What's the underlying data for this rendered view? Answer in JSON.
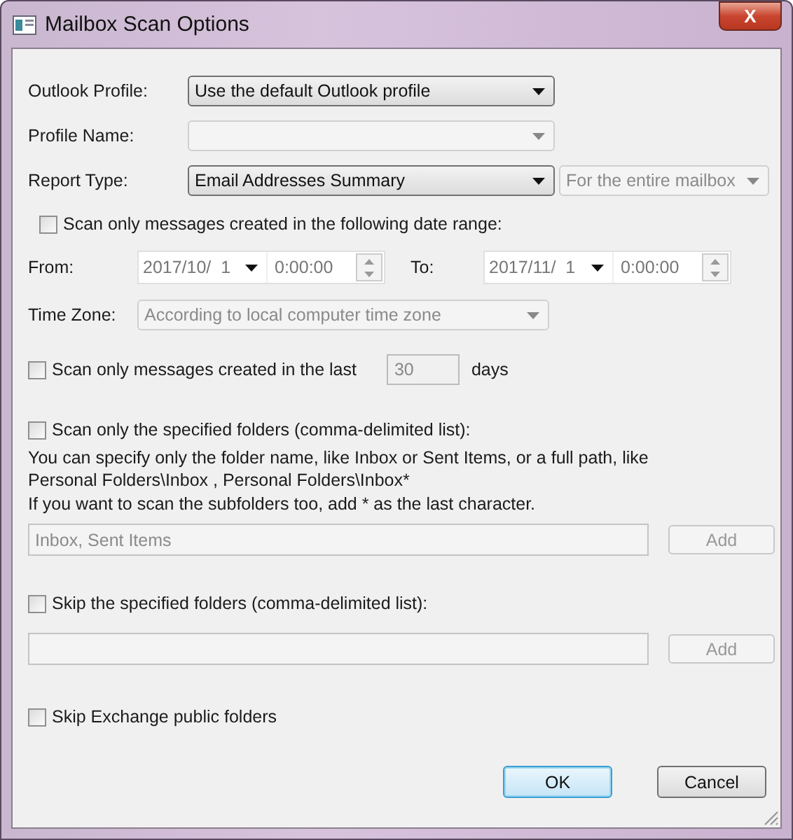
{
  "window": {
    "title": "Mailbox Scan Options",
    "close": "X"
  },
  "outlook_profile": {
    "label": "Outlook Profile:",
    "value": "Use the default Outlook profile",
    "disabled": false
  },
  "profile_name": {
    "label": "Profile Name:",
    "disabled": true
  },
  "report_type": {
    "label": "Report Type:",
    "value": "Email Addresses Summary",
    "disabled": false,
    "scope": {
      "value": "For the entire mailbox",
      "disabled": true
    }
  },
  "date_range": {
    "label": "Scan only messages created in the following date range:",
    "checked": false,
    "from": {
      "label": "From:",
      "date": "2017/10/  1",
      "time": "0:00:00"
    },
    "to": {
      "label": "To:",
      "date": "2017/11/  1",
      "time": "0:00:00"
    },
    "time_zone": {
      "label": "Time Zone:",
      "value": "According to local computer time zone",
      "disabled": true
    }
  },
  "last_days": {
    "label": "Scan only messages created in the last",
    "checked": false,
    "value": "30",
    "unit": "days"
  },
  "include_folders": {
    "label": "Scan only the specified folders (comma-delimited list):",
    "checked": false,
    "help": [
      "You can specify only the folder name, like Inbox or Sent Items, or a full path, like",
      "Personal Folders\\Inbox , Personal Folders\\Inbox*",
      "If you want to scan the subfolders too, add * as the last character."
    ],
    "placeholder": "Inbox, Sent Items",
    "add": {
      "label": "Add",
      "disabled": true
    }
  },
  "skip_folders": {
    "label": "Skip the specified folders (comma-delimited list):",
    "checked": false,
    "add": {
      "label": "Add",
      "disabled": true
    }
  },
  "skip_public": {
    "label": "Skip Exchange public folders",
    "checked": false
  },
  "buttons": [
    {
      "label": "OK",
      "default": true
    },
    {
      "label": "Cancel",
      "default": false
    }
  ]
}
